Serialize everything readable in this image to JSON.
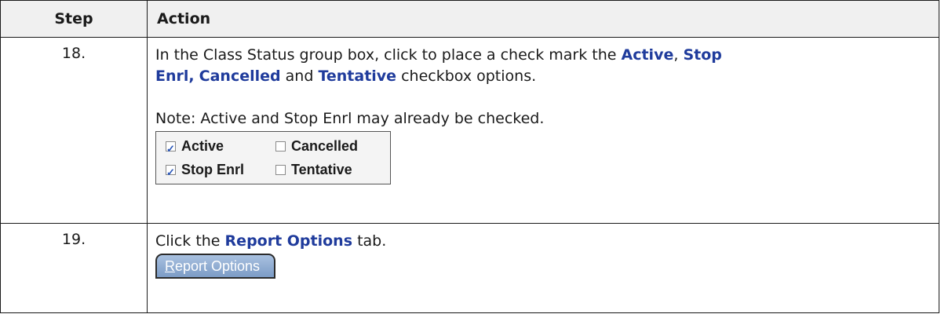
{
  "headers": {
    "step": "Step",
    "action": "Action"
  },
  "rows": [
    {
      "step": "18.",
      "line1_a": "In the Class Status group box, click to place a check mark the ",
      "kw_active": "Active",
      "comma1": ", ",
      "kw_stop": "Stop",
      "kw_enrl": "Enrl,",
      "space1": " ",
      "kw_cancelled": "Cancelled",
      "and": " and ",
      "kw_tentative": "Tentative",
      "line2_end": " checkbox options.",
      "note": "Note: Active and Stop Enrl may already be checked.",
      "checkboxes": [
        {
          "label": "Active",
          "checked": true
        },
        {
          "label": "Cancelled",
          "checked": false
        },
        {
          "label": "Stop Enrl",
          "checked": true
        },
        {
          "label": "Tentative",
          "checked": false
        }
      ]
    },
    {
      "step": "19.",
      "line_a": "Click the ",
      "kw_report": "Report Options",
      "line_b": " tab.",
      "tab_label_first": "R",
      "tab_label_rest": "eport Options"
    }
  ],
  "colors": {
    "keyword": "#1f3b9c",
    "tab_fill": "#8eaad2",
    "check": "#2855b8"
  }
}
